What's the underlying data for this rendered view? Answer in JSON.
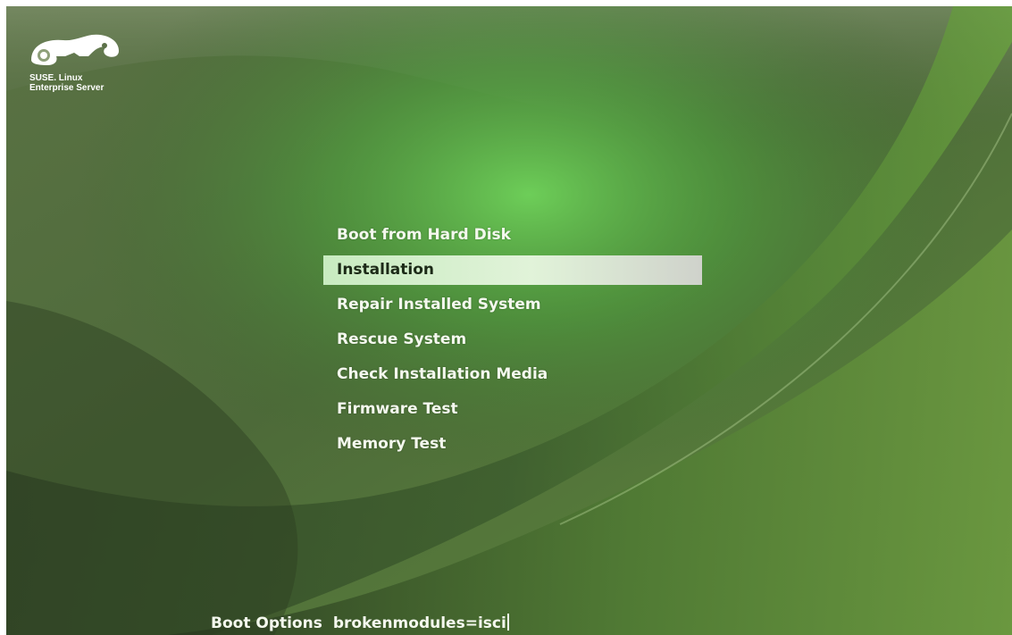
{
  "brand": {
    "line1": "SUSE. Linux",
    "line2": "Enterprise Server"
  },
  "menu": {
    "items": [
      {
        "label": "Boot from Hard Disk",
        "selected": false
      },
      {
        "label": "Installation",
        "selected": true
      },
      {
        "label": "Repair Installed System",
        "selected": false
      },
      {
        "label": "Rescue System",
        "selected": false
      },
      {
        "label": "Check Installation Media",
        "selected": false
      },
      {
        "label": "Firmware Test",
        "selected": false
      },
      {
        "label": "Memory Test",
        "selected": false
      }
    ]
  },
  "boot_options": {
    "label": "Boot Options",
    "value": "brokenmodules=isci"
  },
  "colors": {
    "background_dark": "#3f5a2e",
    "highlight": "#d8f0cf",
    "text": "#f4f8ee"
  },
  "icons": {
    "logo": "suse-chameleon-logo"
  }
}
